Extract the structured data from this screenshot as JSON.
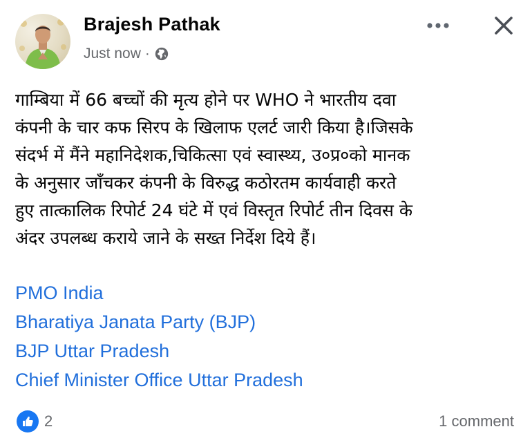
{
  "post": {
    "author": "Brajesh Pathak",
    "timestamp": "Just now",
    "separator": "·",
    "privacy_icon": "globe-icon",
    "avatar_icon": "profile-avatar",
    "menu_icon": "more-options-icon",
    "close_icon": "close-icon",
    "text_lines": [
      "गाम्बिया में 66 बच्चों की मृत्य होने पर WHO ने भारतीय दवा",
      "कंपनी के चार कफ सिरप के खिलाफ एलर्ट जारी किया है।जिसके",
      "संदर्भ में मैंने महानिदेशक,चिकित्सा एवं स्वास्थ्य, उ०प्र०को मानक",
      "के अनुसार जाँचकर कंपनी के विरुद्ध कठोरतम कार्यवाही करते",
      "हुए तात्कालिक रिपोर्ट 24 घंटे में एवं विस्तृत रिपोर्ट तीन दिवस के",
      "अंदर उपलब्ध कराये जाने के सख्त निर्देश दिये हैं।"
    ],
    "tags": [
      "PMO India",
      "Bharatiya Janata Party (BJP)",
      "BJP Uttar Pradesh",
      "Chief Minister Office Uttar Pradesh"
    ],
    "reactions": {
      "icon": "like-icon",
      "count": "2"
    },
    "comments": "1 comment"
  },
  "colors": {
    "link": "#216fdb",
    "secondary_text": "#65676b",
    "like_blue": "#1877f2",
    "primary_text": "#050505"
  }
}
